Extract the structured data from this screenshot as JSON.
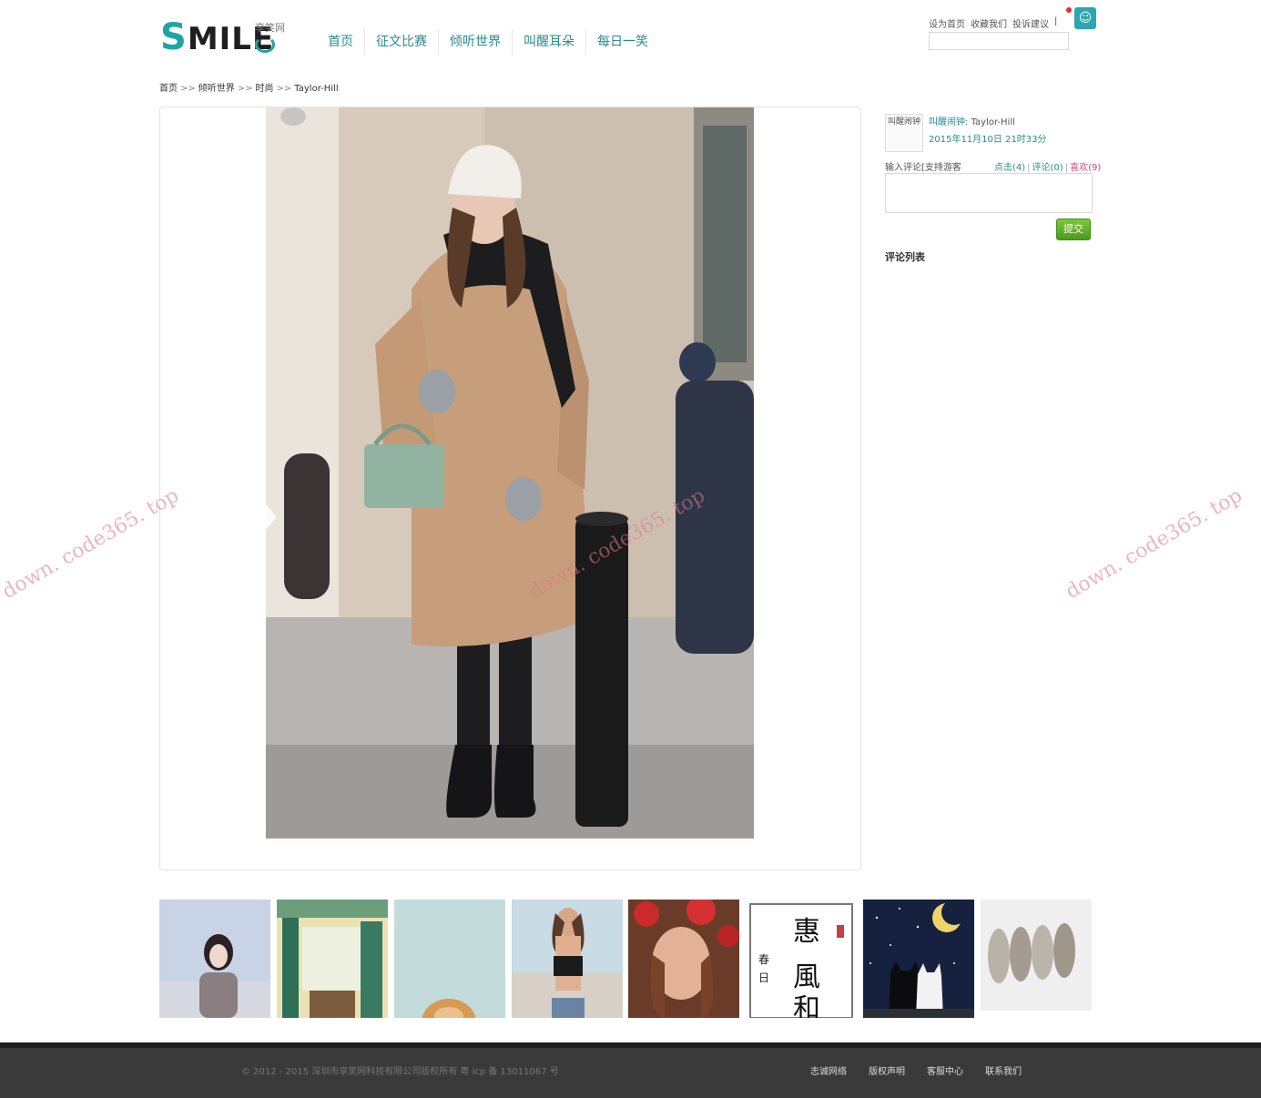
{
  "header": {
    "logo_text": "SMILE",
    "logo_sub": "享笑网",
    "nav": [
      "首页",
      "征文比赛",
      "倾听世界",
      "叫醒耳朵",
      "每日一笑"
    ],
    "top_links": [
      "设为首页",
      "收藏我们",
      "投诉建议",
      "|"
    ]
  },
  "breadcrumb": {
    "items": [
      "首页",
      "倾听世界",
      "时尚",
      "Taylor-Hill"
    ],
    "separator": ">>"
  },
  "post": {
    "avatar_alt": "叫醒闹钟",
    "author_label": "叫醒闹钟:",
    "title": "Taylor-Hill",
    "date": "2015年11月10日 21时33分",
    "comment_label": "输入评论[支持游客",
    "stats": {
      "clicks": "点击(4)",
      "comments": "评论(0)",
      "likes": "喜欢(9)"
    },
    "submit_label": "提交",
    "comment_list_title": "评论列表"
  },
  "footer": {
    "copyright": "© 2012 - 2015 深圳市享笑网科技有限公司版权所有 粤 icp 备 13011067 号",
    "links": [
      "志诚网络",
      "版权声明",
      "客服中心",
      "联系我们"
    ]
  },
  "watermark": "down. code365. top",
  "colors": {
    "accent": "#2a8c8c",
    "like": "#e0407a",
    "submit": "#5aa824",
    "footer": "#3a3a3a"
  }
}
